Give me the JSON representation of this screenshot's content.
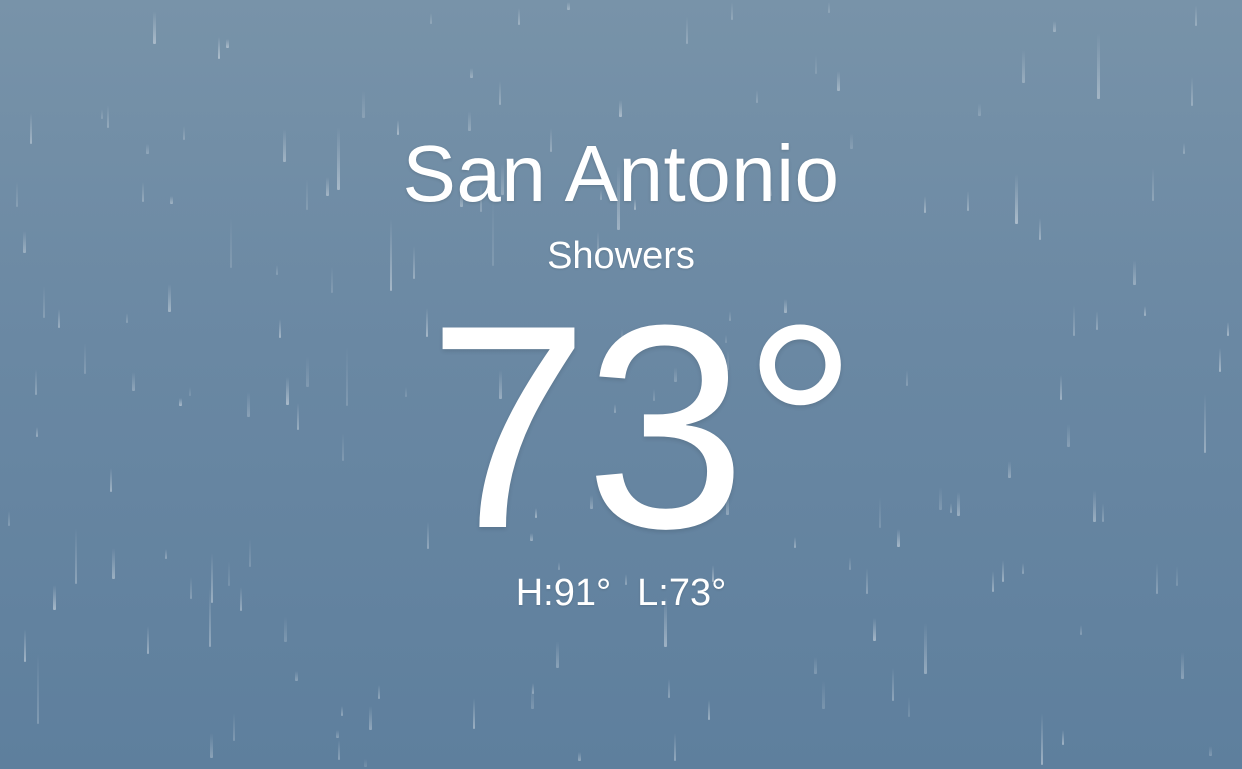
{
  "weather": {
    "city": "San Antonio",
    "condition": "Showers",
    "temperature": "73°",
    "high": "H:91°",
    "low": "L:73°"
  },
  "theme": {
    "background_top": "#7893a9",
    "background_bottom": "#5e7f9d",
    "text_color": "#ffffff",
    "effect": "rain"
  }
}
